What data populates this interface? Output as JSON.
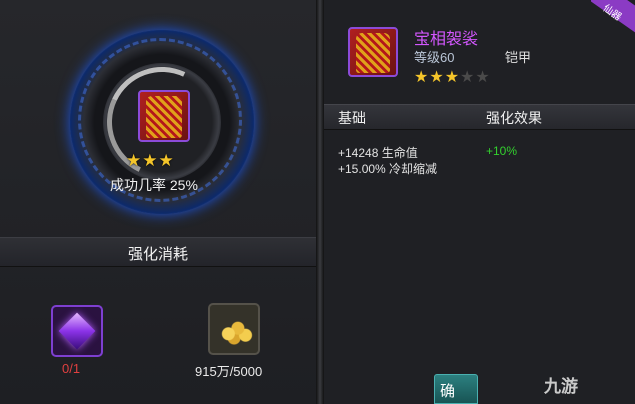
{
  "upgrade": {
    "stars": "★★★",
    "success_rate": "成功几率 25%"
  },
  "cost": {
    "title": "强化消耗",
    "material_count": "0/1",
    "gold": "915万/5000"
  },
  "item": {
    "name": "宝相袈裟",
    "level": "等级60",
    "type": "铠甲",
    "stars_filled": "★★★",
    "stars_empty": "★★",
    "corner_tag": "仙器"
  },
  "stats": {
    "header_base": "基础",
    "header_effect": "强化效果",
    "rows": [
      {
        "text": "+14248 生命值",
        "bonus": "+10%"
      },
      {
        "text": "+15.00% 冷却缩减"
      }
    ]
  },
  "confirm_label": "确",
  "watermark": "九游",
  "colors": {
    "accent_purple": "#d457ff",
    "ring_blue": "#1a4fd0",
    "bonus_green": "#33d12e",
    "cost_red": "#e04040",
    "star_gold": "#f4c52a"
  }
}
